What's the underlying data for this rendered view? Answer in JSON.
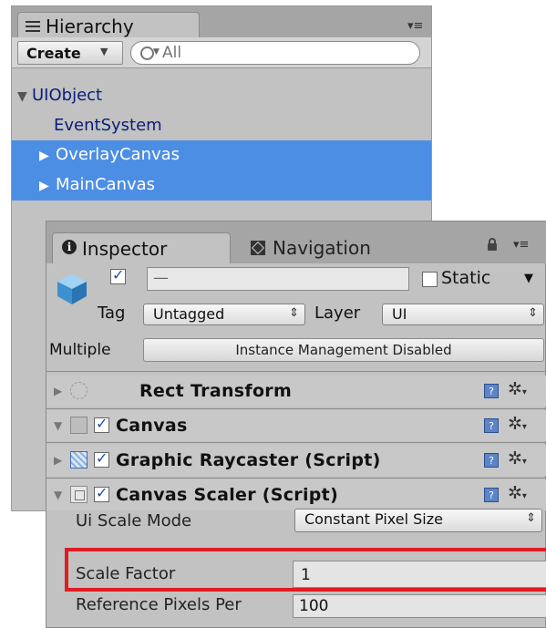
{
  "hierarchy": {
    "tab_label": "Hierarchy",
    "create_label": "Create",
    "search_placeholder": "All",
    "items": [
      {
        "label": "UIObject"
      },
      {
        "label": "EventSystem"
      },
      {
        "label": "OverlayCanvas"
      },
      {
        "label": "MainCanvas"
      }
    ]
  },
  "inspector": {
    "tab_label": "Inspector",
    "nav_tab_label": "Navigation",
    "object_name": "—",
    "active_checked": true,
    "static_label": "Static",
    "static_checked": false,
    "tag_label": "Tag",
    "tag_value": "Untagged",
    "layer_label": "Layer",
    "layer_value": "UI",
    "multiple_label": "Multiple",
    "multiple_button": "Instance Management Disabled",
    "components": [
      {
        "title": "Rect Transform"
      },
      {
        "title": "Canvas"
      },
      {
        "title": "Graphic Raycaster (Script)"
      },
      {
        "title": "Canvas Scaler (Script)"
      }
    ],
    "properties": {
      "ui_scale_mode_label": "Ui Scale Mode",
      "ui_scale_mode_value": "Constant Pixel Size",
      "scale_factor_label": "Scale Factor",
      "scale_factor_value": "1",
      "reference_pixels_label": "Reference Pixels Per",
      "reference_pixels_value": "100"
    }
  },
  "colors": {
    "selection": "#4c8ee4",
    "panel": "#c2c2c2",
    "highlight": "#e01b24"
  }
}
